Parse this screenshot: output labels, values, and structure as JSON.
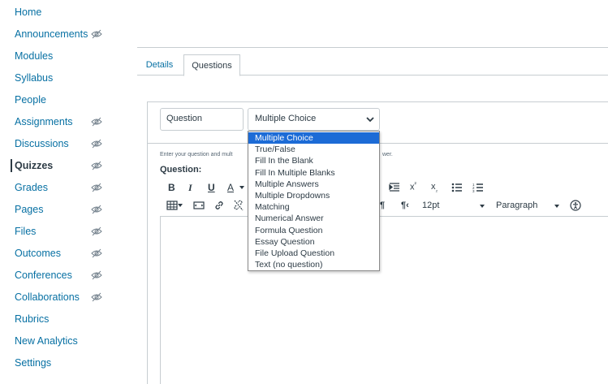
{
  "sidebar": {
    "items": [
      {
        "label": "Home",
        "hidden": false,
        "active": false
      },
      {
        "label": "Announcements",
        "hidden": true,
        "active": false
      },
      {
        "label": "Modules",
        "hidden": false,
        "active": false
      },
      {
        "label": "Syllabus",
        "hidden": false,
        "active": false
      },
      {
        "label": "People",
        "hidden": false,
        "active": false
      },
      {
        "label": "Assignments",
        "hidden": true,
        "active": false
      },
      {
        "label": "Discussions",
        "hidden": true,
        "active": false
      },
      {
        "label": "Quizzes",
        "hidden": true,
        "active": true
      },
      {
        "label": "Grades",
        "hidden": true,
        "active": false
      },
      {
        "label": "Pages",
        "hidden": true,
        "active": false
      },
      {
        "label": "Files",
        "hidden": true,
        "active": false
      },
      {
        "label": "Outcomes",
        "hidden": true,
        "active": false
      },
      {
        "label": "Conferences",
        "hidden": true,
        "active": false
      },
      {
        "label": "Collaborations",
        "hidden": true,
        "active": false
      },
      {
        "label": "Rubrics",
        "hidden": false,
        "active": false
      },
      {
        "label": "New Analytics",
        "hidden": false,
        "active": false
      },
      {
        "label": "Settings",
        "hidden": false,
        "active": false
      }
    ]
  },
  "tabs": {
    "details": "Details",
    "questions": "Questions"
  },
  "question": {
    "name_value": "Question",
    "type_value": "Multiple Choice",
    "instructions_visible": "Enter your question and mult",
    "instructions_tail": "wer.",
    "label": "Question:"
  },
  "toolbar": {
    "font_size": "12pt",
    "block_format": "Paragraph",
    "bold": "B",
    "italic": "I",
    "underline": "U",
    "text_color": "A",
    "ltr": "¶",
    "rtl": "¶‹"
  },
  "dropdown": {
    "options": [
      "Multiple Choice",
      "True/False",
      "Fill In the Blank",
      "Fill In Multiple Blanks",
      "Multiple Answers",
      "Multiple Dropdowns",
      "Matching",
      "Numerical Answer",
      "Formula Question",
      "Essay Question",
      "File Upload Question",
      "Text (no question)"
    ],
    "selected_index": 0
  },
  "colors": {
    "link": "#0770a3",
    "text": "#2d3b45",
    "border": "#c7cdd1",
    "selected": "#1c6bd6"
  }
}
